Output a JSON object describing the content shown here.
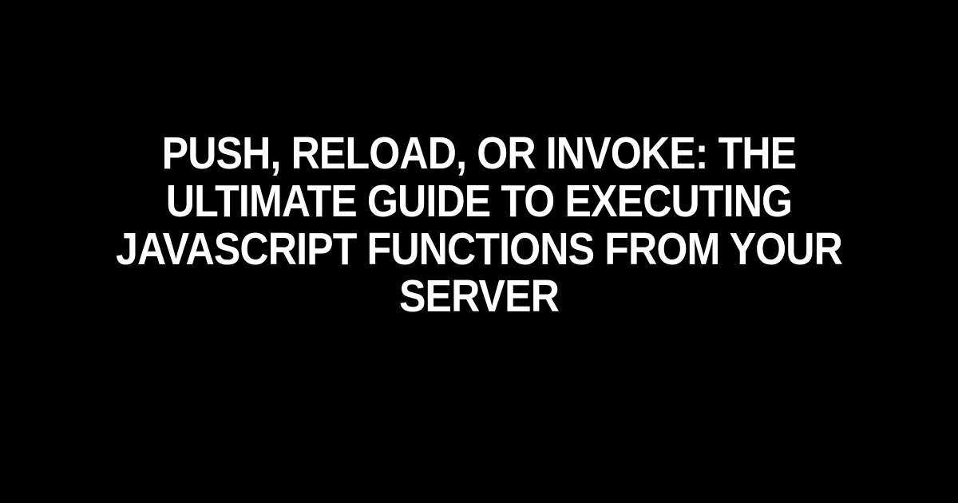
{
  "title": "Push, Reload, or Invoke: The Ultimate Guide to Executing JavaScript Functions from Your Server"
}
